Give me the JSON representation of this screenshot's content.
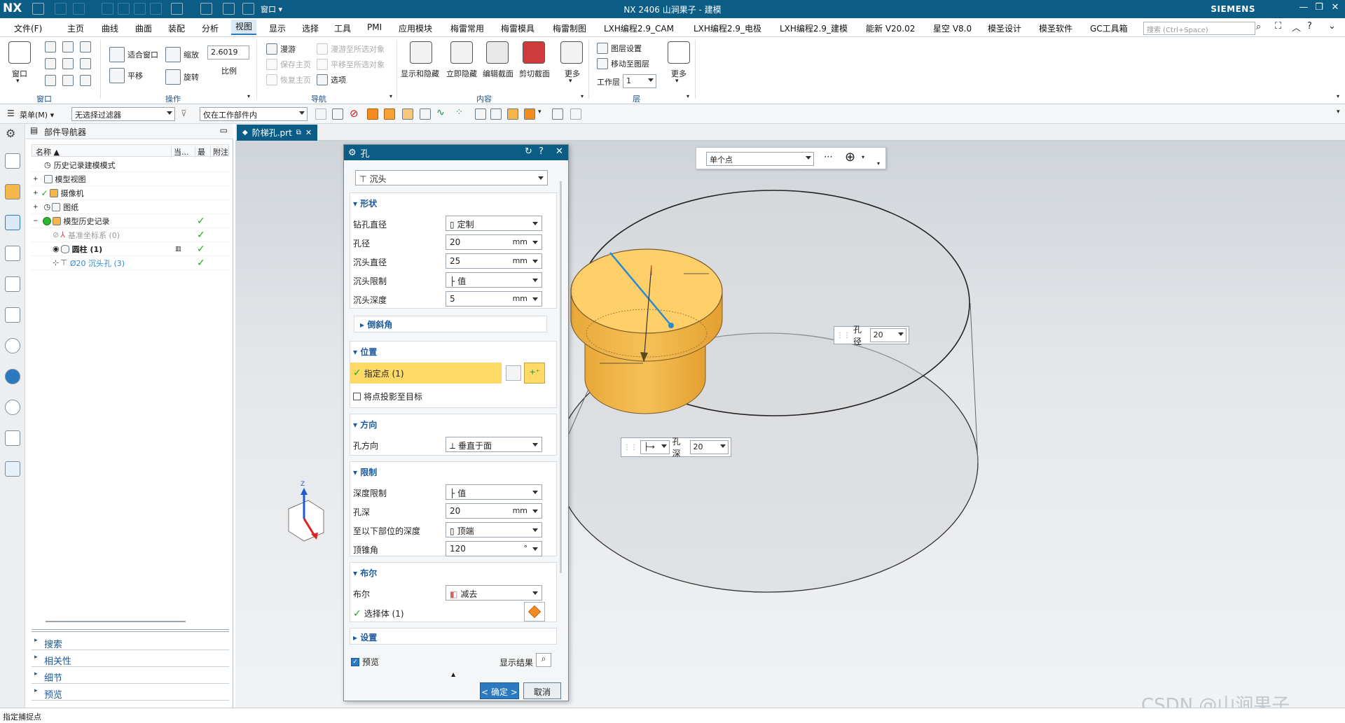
{
  "app": {
    "logo": "NX",
    "title": "NX 2406 山涧果子 - 建模",
    "brand": "SIEMENS",
    "window_label": "窗口"
  },
  "menu": {
    "items": [
      "文件(F)",
      "主页",
      "曲线",
      "曲面",
      "装配",
      "分析",
      "视图",
      "显示",
      "选择",
      "工具",
      "PMI",
      "应用模块",
      "梅雷常用",
      "梅雷模具",
      "梅雷制图",
      "LXH编程2.9_CAM",
      "LXH编程2.9_电极",
      "LXH编程2.9_建模",
      "能新 V20.02",
      "星空 V8.0",
      "模圣设计",
      "模圣软件",
      "GC工具箱"
    ],
    "active": "视图",
    "search_placeholder": "搜索 (Ctrl+Space)"
  },
  "ribbon": {
    "window_group": {
      "label": "窗口",
      "big_button": "窗口"
    },
    "operate_group": {
      "label": "操作",
      "fit": "适合窗口",
      "zoom": "缩放",
      "zoom_value": "2.6019",
      "scale": "比例",
      "pan": "平移",
      "rotate": "旋转"
    },
    "nav_group": {
      "label": "导航",
      "roam": "漫游",
      "save_page": "保存主页",
      "restore_page": "恢复主页",
      "roam_selected": "漫游至所选对象",
      "pan_selected": "平移至所选对象",
      "options": "选项"
    },
    "content_group": {
      "label": "内容",
      "show_hide": "显示和隐藏",
      "instant_hide": "立即隐藏",
      "edit_section": "编辑截面",
      "clip_section": "剪切截面",
      "more": "更多"
    },
    "layer_group": {
      "label": "层",
      "layer_settings": "图层设置",
      "move_to_layer": "移动至图层",
      "work_layer": "工作层",
      "work_layer_value": "1",
      "more": "更多"
    }
  },
  "toolbar2": {
    "menu": "菜单(M)",
    "filter": "无选择过滤器",
    "scope": "仅在工作部件内"
  },
  "navigator": {
    "title": "部件导航器",
    "columns": [
      "名称",
      "当...",
      "最",
      "附注"
    ],
    "rows": [
      {
        "name": "历史记录建模模式",
        "check": ""
      },
      {
        "name": "模型视图",
        "check": ""
      },
      {
        "name": "摄像机",
        "check": ""
      },
      {
        "name": "图纸",
        "check": ""
      },
      {
        "name": "模型历史记录",
        "check": "✓"
      },
      {
        "name": "基准坐标系 (0)",
        "check": "✓"
      },
      {
        "name": "圆柱 (1)",
        "check": "✓"
      },
      {
        "name": "Ø20 沉头孔 (3)",
        "check": "✓"
      }
    ],
    "accordion": [
      "搜索",
      "相关性",
      "细节",
      "预览"
    ]
  },
  "doc_tab": "阶梯孔.prt",
  "dialog": {
    "title": "孔",
    "type": "沉头",
    "shape": {
      "header": "形状",
      "drill_dia_label": "钻孔直径",
      "drill_dia_value": "定制",
      "hole_dia_label": "孔径",
      "hole_dia_value": "20",
      "hole_dia_unit": "mm",
      "cb_dia_label": "沉头直径",
      "cb_dia_value": "25",
      "cb_dia_unit": "mm",
      "cb_limit_label": "沉头限制",
      "cb_limit_value": "值",
      "cb_depth_label": "沉头深度",
      "cb_depth_value": "5",
      "cb_depth_unit": "mm",
      "chamfer": "倒斜角"
    },
    "position": {
      "header": "位置",
      "specify_point": "指定点 (1)",
      "project": "将点投影至目标"
    },
    "direction": {
      "header": "方向",
      "label": "孔方向",
      "value": "垂直于面"
    },
    "limit": {
      "header": "限制",
      "depth_limit_label": "深度限制",
      "depth_limit_value": "值",
      "hole_depth_label": "孔深",
      "hole_depth_value": "20",
      "hole_depth_unit": "mm",
      "to_label": "至以下部位的深度",
      "to_value": "顶端",
      "tip_label": "顶锥角",
      "tip_value": "120",
      "tip_unit": "°"
    },
    "boolean": {
      "header": "布尔",
      "label": "布尔",
      "value": "减去",
      "select_body": "选择体 (1)"
    },
    "settings": "设置",
    "preview": "预览",
    "show_result": "显示结果",
    "ok": "< 确定 >",
    "cancel": "取消"
  },
  "float_toolbar": {
    "point_type": "单个点"
  },
  "onscreen": {
    "hole_dia_label": "孔径",
    "hole_dia_value": "20",
    "hole_depth_label": "孔深",
    "hole_depth_value": "20"
  },
  "triad": {
    "z": "Z"
  },
  "status": {
    "text": "指定捕捉点"
  },
  "watermark": "CSDN @山涧果子",
  "colors": {
    "title_bar": "#0b5d86",
    "accent": "#2a79c1",
    "hole_fill": "#f5b64a",
    "highlight": "#ffd966"
  }
}
